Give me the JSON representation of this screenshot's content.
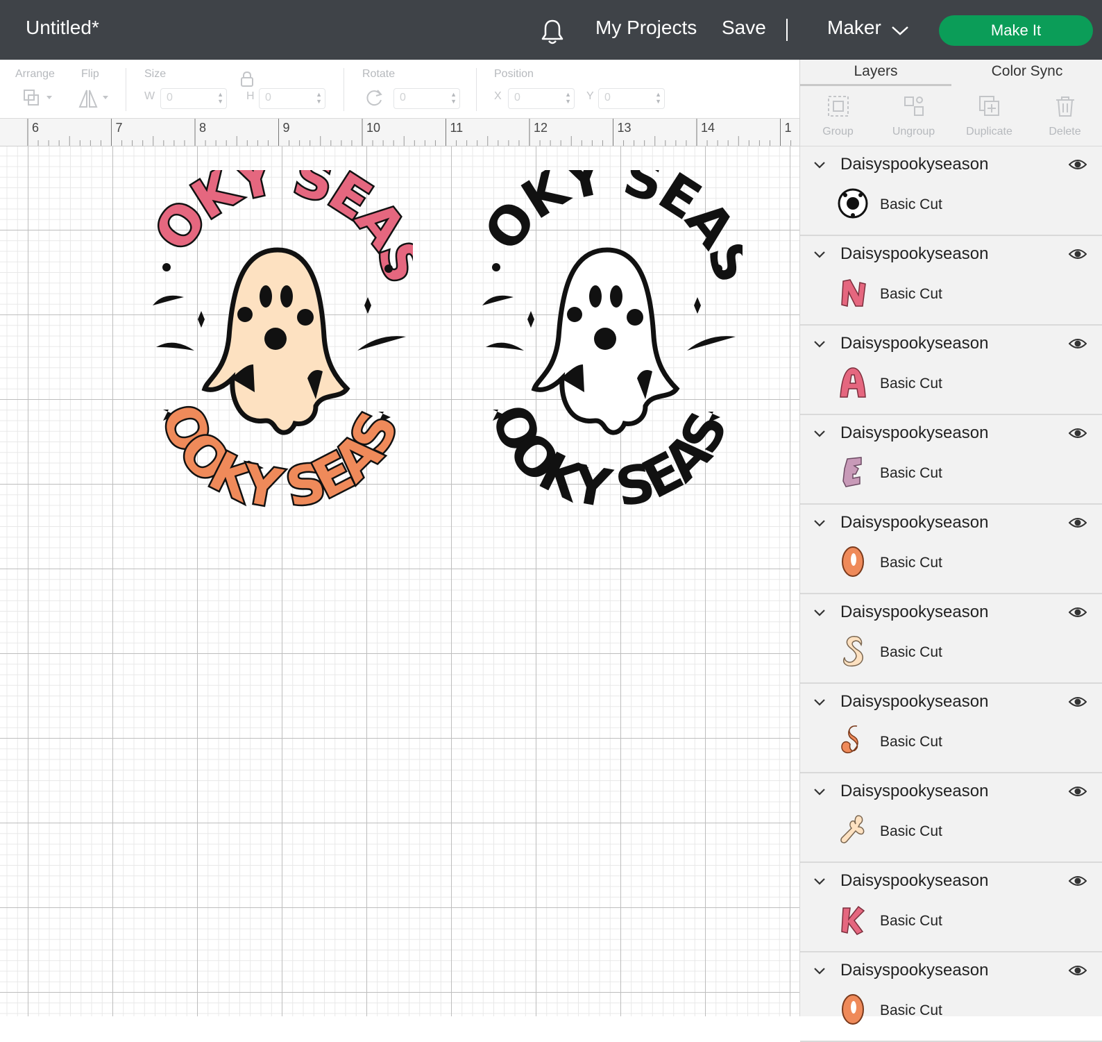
{
  "header": {
    "title": "Untitled*",
    "my_projects": "My Projects",
    "save": "Save",
    "machine": "Maker",
    "make_it": "Make It"
  },
  "toolbar": {
    "arrange": "Arrange",
    "flip": "Flip",
    "size": "Size",
    "w_label": "W",
    "w_value": "0",
    "h_label": "H",
    "h_value": "0",
    "rotate": "Rotate",
    "rotate_value": "0",
    "position": "Position",
    "x_label": "X",
    "x_value": "0",
    "y_label": "Y",
    "y_value": "0"
  },
  "ruler": {
    "labels": [
      "6",
      "7",
      "8",
      "9",
      "10",
      "11",
      "12",
      "13",
      "14",
      "1"
    ]
  },
  "canvas": {
    "design_color": {
      "text": "SPOOKY SEASON"
    },
    "design_black": {
      "text": "SPOOKY SEASON"
    }
  },
  "panel": {
    "tabs": [
      "Layers",
      "Color Sync"
    ],
    "actions": [
      "Group",
      "Ungroup",
      "Duplicate",
      "Delete"
    ],
    "layers": [
      {
        "name": "Daisyspookyseason",
        "op": "Basic Cut",
        "icon": "design-thumbnail",
        "color": "#111111"
      },
      {
        "name": "Daisyspookyseason",
        "op": "Basic Cut",
        "icon": "letter-n-pink",
        "color": "#e5677f"
      },
      {
        "name": "Daisyspookyseason",
        "op": "Basic Cut",
        "icon": "letter-a-pink",
        "color": "#e5677f"
      },
      {
        "name": "Daisyspookyseason",
        "op": "Basic Cut",
        "icon": "letter-e-mauve",
        "color": "#c89ab8"
      },
      {
        "name": "Daisyspookyseason",
        "op": "Basic Cut",
        "icon": "letter-o-orange",
        "color": "#ef8a5a"
      },
      {
        "name": "Daisyspookyseason",
        "op": "Basic Cut",
        "icon": "letter-s-cream",
        "color": "#fde1c1"
      },
      {
        "name": "Daisyspookyseason",
        "op": "Basic Cut",
        "icon": "letter-s-orange",
        "color": "#ef8a5a"
      },
      {
        "name": "Daisyspookyseason",
        "op": "Basic Cut",
        "icon": "letter-y-cream",
        "color": "#fde1c1"
      },
      {
        "name": "Daisyspookyseason",
        "op": "Basic Cut",
        "icon": "letter-k-pink",
        "color": "#e5677f"
      },
      {
        "name": "Daisyspookyseason",
        "op": "Basic Cut",
        "icon": "letter-o-orange",
        "color": "#ef8a5a"
      }
    ]
  },
  "colors": {
    "topbar": "#3f4348",
    "make_it": "#0b9d58",
    "pink": "#e5677f",
    "cream": "#fde1c1",
    "orange": "#ef8a5a",
    "mauve": "#c89ab8",
    "ink": "#111111"
  }
}
